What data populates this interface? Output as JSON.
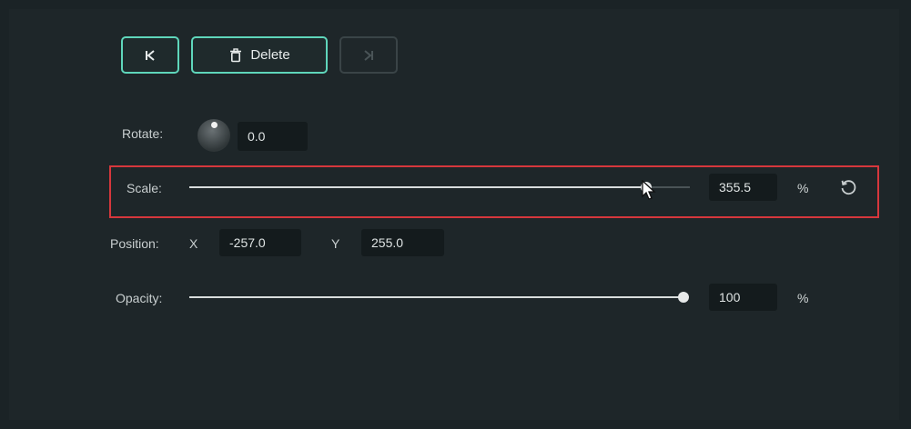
{
  "toolbar": {
    "prev_keyframe_glyph": "K",
    "delete_label": "Delete",
    "next_keyframe_glyph": "K"
  },
  "rotate": {
    "label": "Rotate:",
    "value": "0.0"
  },
  "scale": {
    "label": "Scale:",
    "value": "355.5",
    "unit": "%",
    "slider_fraction": 0.9
  },
  "position": {
    "label": "Position:",
    "x_label": "X",
    "x_value": "-257.0",
    "y_label": "Y",
    "y_value": "255.0"
  },
  "opacity": {
    "label": "Opacity:",
    "value": "100",
    "unit": "%",
    "slider_fraction": 1.0
  },
  "colors": {
    "accent": "#5fd6bb",
    "highlight": "#d6373c"
  }
}
